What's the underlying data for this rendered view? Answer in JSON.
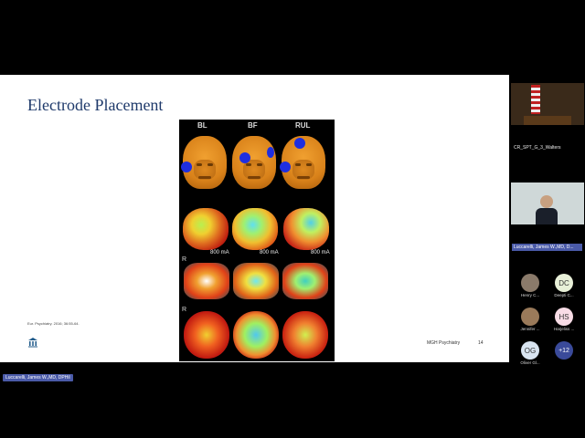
{
  "slide": {
    "title": "Electrode Placement",
    "figure": {
      "columns": [
        "BL",
        "BF",
        "RUL"
      ],
      "current_labels": [
        "800 mA",
        "800 mA",
        "800 mA"
      ],
      "row_labels": [
        "R",
        "R"
      ]
    },
    "citation": "Eur. Psychiatry. 2016; 36:55-64.",
    "footer_left": "MGH Psychiatry",
    "page_number": "14"
  },
  "speaker_tag": "Luccarelli, James W.,MD, DPHil",
  "gallery": {
    "room_tile_name": "CR_SPT_G_3_Walters",
    "speaker_badge": "Luccarelli, James W.,MD, D...",
    "participants": [
      {
        "initials": "",
        "name": "Henry C...",
        "avatar": "photo"
      },
      {
        "initials": "DC",
        "name": "Deepti C...",
        "avatar": "initials"
      },
      {
        "initials": "",
        "name": "Jennifer ...",
        "avatar": "photo"
      },
      {
        "initials": "HS",
        "name": "Harjeliss ...",
        "avatar": "initials"
      },
      {
        "initials": "OG",
        "name": "Oliver Gl...",
        "avatar": "initials"
      },
      {
        "initials": "+12",
        "name": "",
        "avatar": "more"
      }
    ]
  },
  "colors": {
    "title": "#1f3a6b",
    "speaker_tag": "#4a5aa8",
    "avatar_dc": "#e8f0d8",
    "avatar_hs": "#f8dce6",
    "avatar_og": "#d8e4f0",
    "avatar_more": "#3a4a9a"
  }
}
